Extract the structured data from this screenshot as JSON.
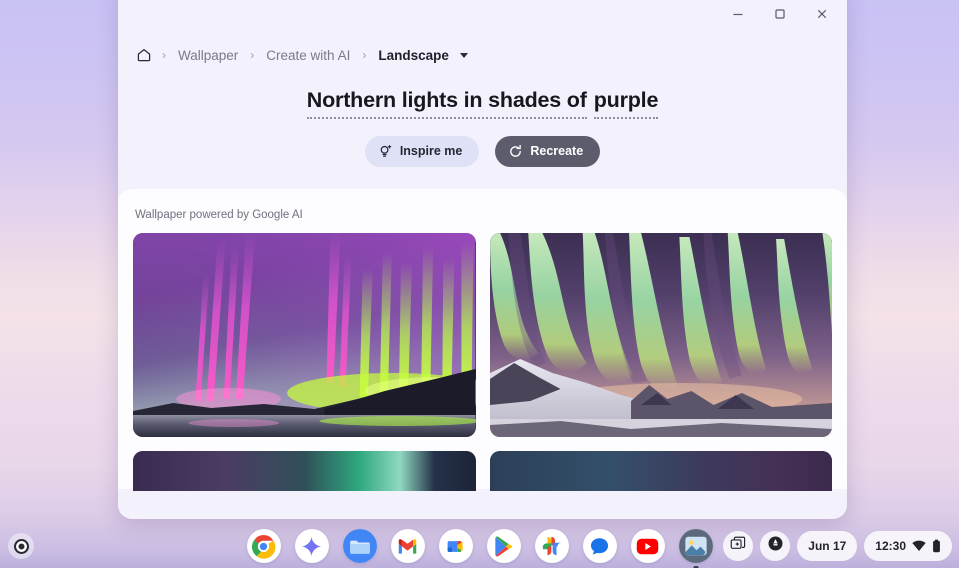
{
  "window": {
    "controls": {
      "minimize": "minimize",
      "maximize": "maximize",
      "close": "close"
    }
  },
  "breadcrumb": {
    "home_icon": "home-icon",
    "separator": "›",
    "items": [
      {
        "label": "Wallpaper",
        "current": false
      },
      {
        "label": "Create with AI",
        "current": false
      },
      {
        "label": "Landscape",
        "current": true
      }
    ]
  },
  "prompt": {
    "segment_one": "Northern lights in shades of",
    "segment_two": "purple"
  },
  "actions": {
    "inspire_label": "Inspire me",
    "inspire_icon": "lightbulb-sparkle-icon",
    "recreate_label": "Recreate",
    "recreate_icon": "refresh-icon"
  },
  "content": {
    "caption": "Wallpaper powered by Google AI",
    "results": [
      {
        "name": "aurora-purple-lake",
        "alt": "Purple and green aurora over a lake with mountains"
      },
      {
        "name": "aurora-green-curtains",
        "alt": "Green aurora curtains over snowy mountains"
      },
      {
        "name": "aurora-result-3",
        "alt": "Partially visible wallpaper result"
      },
      {
        "name": "aurora-result-4",
        "alt": "Partially visible wallpaper result"
      }
    ]
  },
  "shelf": {
    "launcher": "launcher-button",
    "apps": [
      {
        "name": "chrome",
        "label": "Chrome"
      },
      {
        "name": "gemini",
        "label": "Gemini"
      },
      {
        "name": "files",
        "label": "Files"
      },
      {
        "name": "gmail",
        "label": "Gmail"
      },
      {
        "name": "meet",
        "label": "Google Meet"
      },
      {
        "name": "play-store",
        "label": "Play Store"
      },
      {
        "name": "photos",
        "label": "Google Photos"
      },
      {
        "name": "messages",
        "label": "Messages"
      },
      {
        "name": "youtube",
        "label": "YouTube"
      },
      {
        "name": "wallpaper",
        "label": "Wallpaper & style"
      }
    ],
    "tray": {
      "screen_capture_icon": "screen-capture-icon",
      "quick_settings_icon": "quick-settings-icon",
      "date": "Jun 17",
      "time": "12:30",
      "wifi_icon": "wifi-icon",
      "battery_icon": "battery-icon"
    }
  },
  "colors": {
    "window_header_bg": "#f3f1fb",
    "content_bg": "#fdfcfe",
    "inspire_bg": "#dfe2f6",
    "recreate_bg": "#5c5c6c",
    "text_primary": "#17171f",
    "text_muted": "#7a7a88"
  }
}
